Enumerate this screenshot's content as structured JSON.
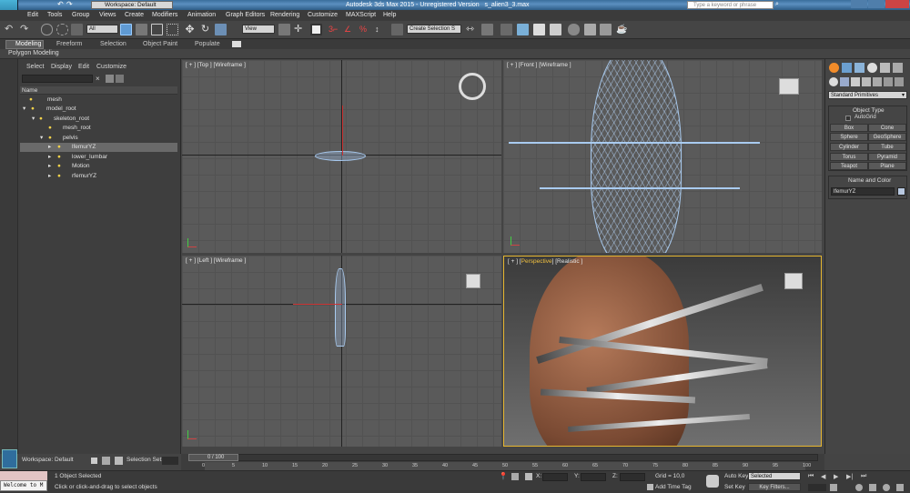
{
  "window": {
    "title": "Autodesk 3ds Max 2015 - Unregistered Version   s_alien3_3.max",
    "workspace": "Workspace: Default",
    "search_placeholder": "Type a keyword or phrase"
  },
  "menu": [
    "Edit",
    "Tools",
    "Group",
    "Views",
    "Create",
    "Modifiers",
    "Animation",
    "Graph Editors",
    "Rendering",
    "Customize",
    "MAXScript",
    "Help"
  ],
  "toolbar": {
    "filter": "All",
    "ref_coord": "View",
    "selection_set": "Create Selection S"
  },
  "ribbon": {
    "tabs": [
      "Modeling",
      "Freeform",
      "Selection",
      "Object Paint",
      "Populate"
    ],
    "sub": "Polygon Modeling"
  },
  "scene_explorer": {
    "tabs": [
      "Select",
      "Display",
      "Edit",
      "Customize"
    ],
    "column": "Name",
    "items": [
      "mesh",
      "model_root",
      "skeleton_root",
      "mesh_root",
      "pelvis",
      "lfemurYZ",
      "lower_lumbar",
      "Motion",
      "rfemurYZ"
    ]
  },
  "viewports": {
    "top": "[ + ] [Top ] [Wireframe ]",
    "front": "[ + ] [Front ] [Wireframe ]",
    "left": "[ + ] [Left ] [Wireframe ]",
    "persp_a": "[ + ] [",
    "persp_b": "Perspective",
    "persp_c": "] [Realistic ]"
  },
  "command_panel": {
    "dropdown": "Standard Primitives",
    "object_type": "Object Type",
    "autogrid": "AutoGrid",
    "buttons": [
      "Box",
      "Cone",
      "Sphere",
      "GeoSphere",
      "Cylinder",
      "Tube",
      "Torus",
      "Pyramid",
      "Teapot",
      "Plane"
    ],
    "name_color": "Name and Color",
    "name_value": "lfemurYZ"
  },
  "timeline": {
    "frame": "0 / 100",
    "ticks": [
      "0",
      "5",
      "10",
      "15",
      "20",
      "25",
      "30",
      "35",
      "40",
      "45",
      "50",
      "55",
      "60",
      "65",
      "70",
      "75",
      "80",
      "85",
      "90",
      "95",
      "100"
    ]
  },
  "status": {
    "workspace": "Workspace: Default",
    "selection_set": "Selection Set:",
    "selected": "1 Object Selected",
    "hint": "Click or click-and-drag to select objects",
    "welcome": "Welcome to M",
    "grid": "Grid = 10,0",
    "add_time_tag": "Add Time Tag",
    "auto_key": "Auto Key",
    "set_key": "Set Key",
    "selected_dd": "Selected",
    "key_filters": "Key Filters...",
    "x_label": "X:",
    "y_label": "Y:",
    "z_label": "Z:"
  }
}
